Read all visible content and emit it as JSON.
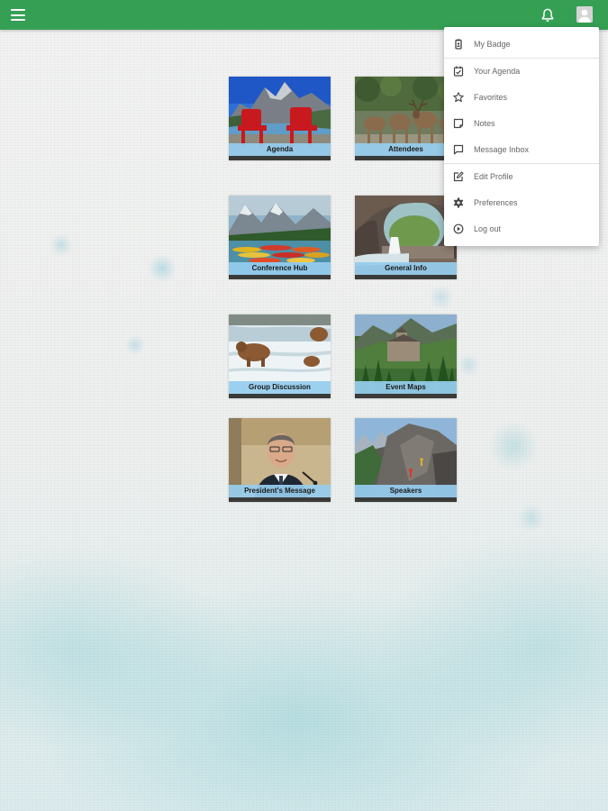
{
  "header": {
    "menu_icon": "hamburger-icon",
    "notifications_icon": "bell-icon",
    "profile_icon": "user-avatar-icon",
    "bar_color": "#35a054"
  },
  "tiles": [
    {
      "label": "Agenda",
      "image": "lake-with-red-chairs"
    },
    {
      "label": "Attendees",
      "image": "elk-herd"
    },
    {
      "label": "Conference Hub",
      "image": "lake-with-canoes"
    },
    {
      "label": "General Info",
      "image": "waterfall-through-rock-arch"
    },
    {
      "label": "Group Discussion",
      "image": "bears-fishing-in-river"
    },
    {
      "label": "Event Maps",
      "image": "castle-hotel-in-forest"
    },
    {
      "label": "President's Message",
      "image": "president-speaking-at-podium"
    },
    {
      "label": "Speakers",
      "image": "climbers-on-mountain-cliff"
    }
  ],
  "user_menu": {
    "items": [
      {
        "label": "My Badge",
        "icon": "badge-icon"
      },
      {
        "label": "Your Agenda",
        "icon": "calendar-check-icon"
      },
      {
        "label": "Favorites",
        "icon": "star-icon"
      },
      {
        "label": "Notes",
        "icon": "note-icon"
      },
      {
        "label": "Message Inbox",
        "icon": "message-icon"
      },
      {
        "label": "Edit Profile",
        "icon": "edit-icon"
      },
      {
        "label": "Preferences",
        "icon": "gear-icon"
      },
      {
        "label": "Log out",
        "icon": "logout-icon"
      }
    ]
  },
  "tile_label_color": "#96ccee"
}
